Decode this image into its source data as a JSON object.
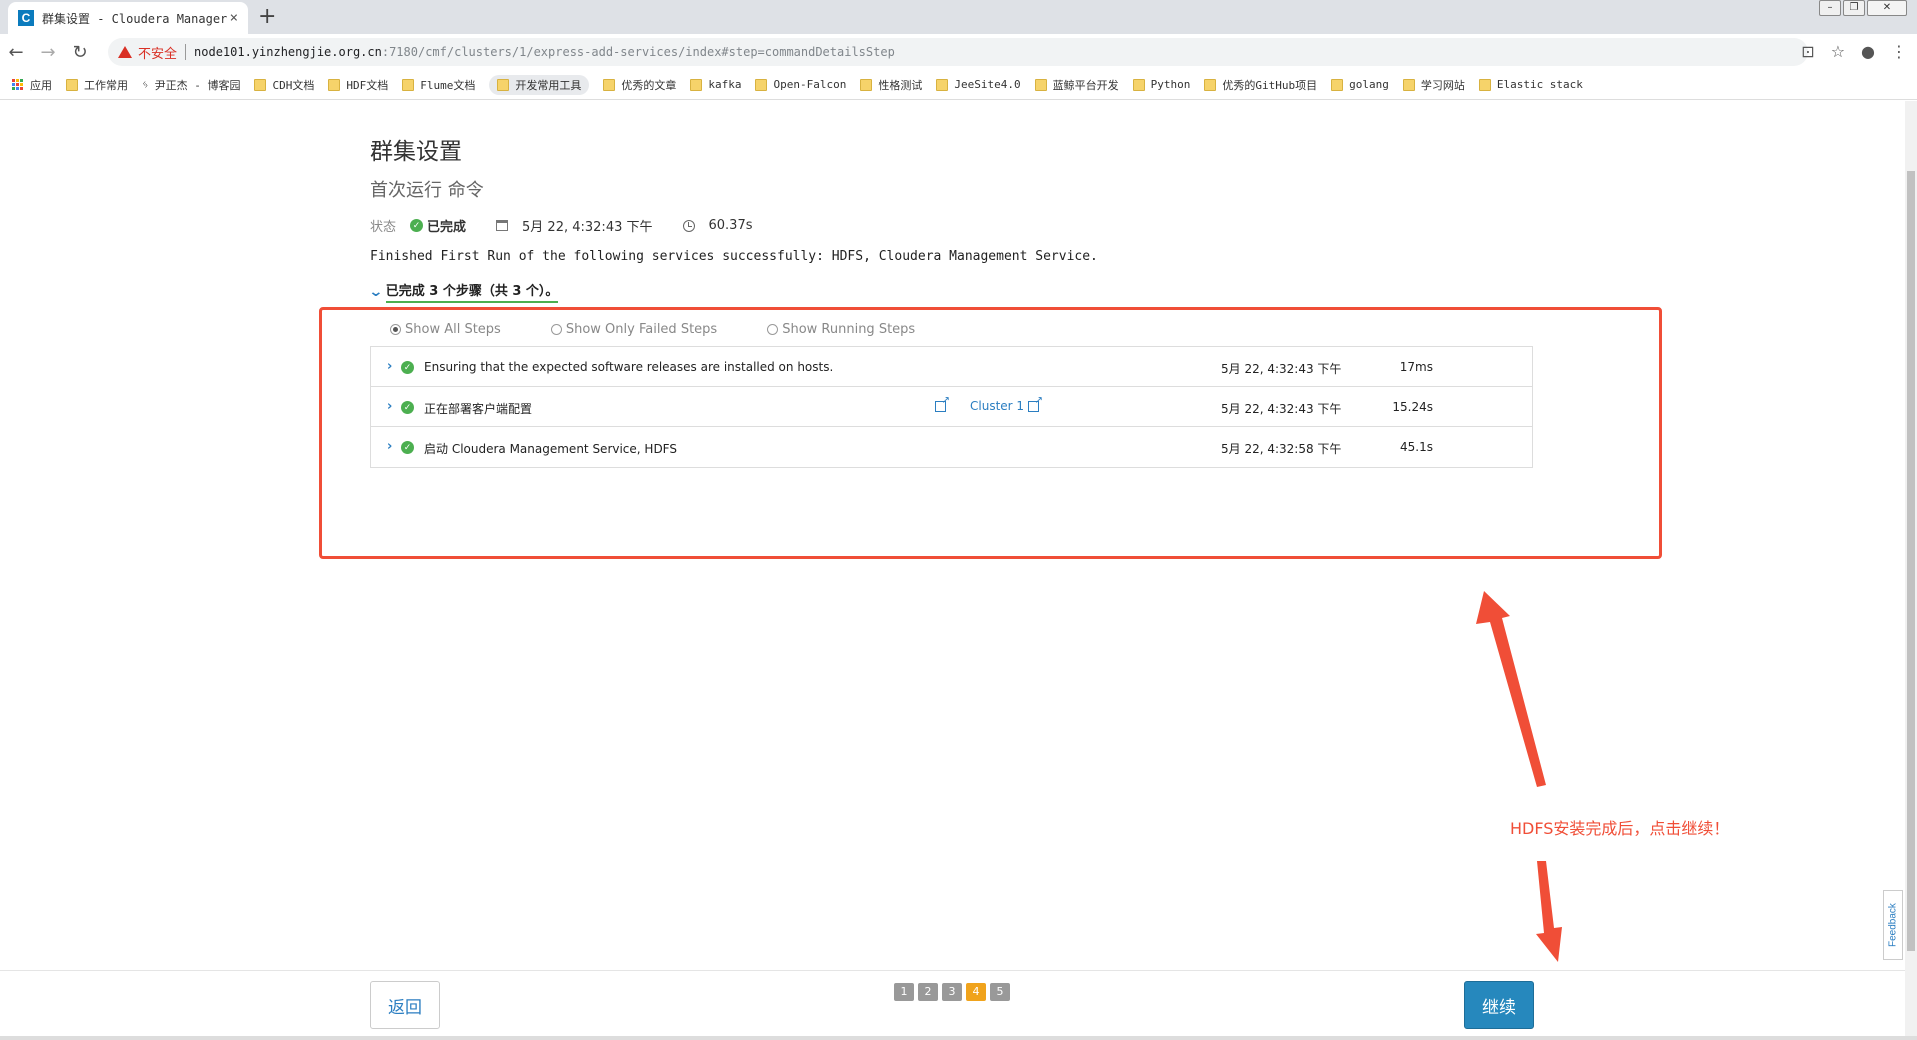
{
  "browser": {
    "tab_title": "群集设置 - Cloudera Manager",
    "tab_close": "×",
    "new_tab": "+",
    "favicon": "C",
    "security_label": "不安全",
    "url_host": "node101.yinzhengjie.org.cn",
    "url_path": ":7180/cmf/clusters/1/express-add-services/index#step=commandDetailsStep",
    "icons": [
      "back-icon",
      "forward-icon",
      "reload-icon",
      "translate-icon",
      "star-icon",
      "account-icon",
      "menu-icon"
    ]
  },
  "bookmarks": {
    "apps_label": "应用",
    "items": [
      "工作常用",
      "尹正杰 - 博客园",
      "CDH文档",
      "HDF文档",
      "Flume文档",
      "开发常用工具",
      "优秀的文章",
      "kafka",
      "Open-Falcon",
      "性格测试",
      "JeeSite4.0",
      "蓝鲸平台开发",
      "Python",
      "优秀的GitHub项目",
      "golang",
      "学习网站",
      "Elastic stack"
    ]
  },
  "page": {
    "title": "群集设置",
    "subtitle": "首次运行 命令",
    "status_label": "状态",
    "status_value": "已完成",
    "start_time": "5月 22, 4:32:43 下午",
    "duration": "60.37s",
    "message": "Finished First Run of the following services successfully: HDFS, Cloudera Management Service.",
    "steps_summary": "已完成 3 个步骤（共 3 个）。",
    "filters": [
      "Show All Steps",
      "Show Only Failed Steps",
      "Show Running Steps"
    ],
    "selected_filter": "Show All Steps",
    "steps": [
      {
        "name": "Ensuring that the expected software releases are installed on hosts.",
        "cluster": "",
        "time": "5月 22, 4:32:43 下午",
        "duration": "17ms"
      },
      {
        "name": "正在部署客户端配置",
        "cluster": "Cluster 1",
        "time": "5月 22, 4:32:43 下午",
        "duration": "15.24s"
      },
      {
        "name": "启动 Cloudera Management Service, HDFS",
        "cluster": "",
        "time": "5月 22, 4:32:58 下午",
        "duration": "45.1s"
      }
    ]
  },
  "annotation": {
    "text": "HDFS安装完成后，点击继续！",
    "color": "#f04e37"
  },
  "footer": {
    "back_label": "返回",
    "continue_label": "继续",
    "pages": [
      "1",
      "2",
      "3",
      "4",
      "5"
    ],
    "current_page": "4"
  },
  "feedback_label": "Feedback",
  "colors": {
    "accent": "#2b7ec1",
    "success": "#4caf50",
    "primary_button": "#2688bd",
    "pager_current": "#f0a31c"
  }
}
